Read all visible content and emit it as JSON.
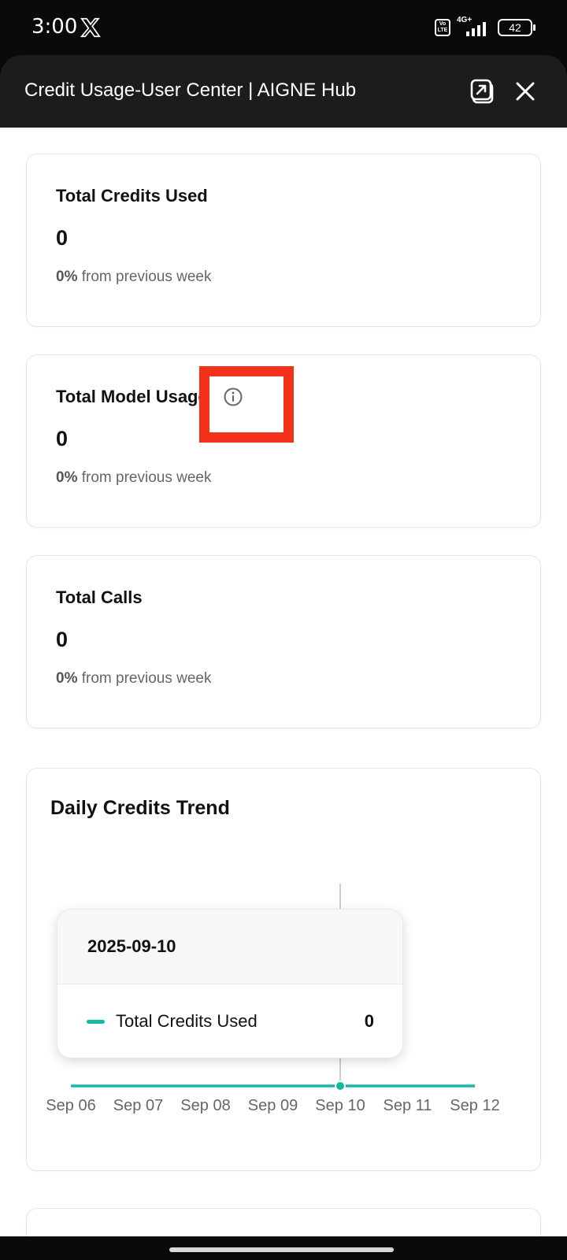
{
  "status_bar": {
    "time": "3:00",
    "volte_label": "Vo LTE",
    "network_label": "4G+",
    "battery": "42"
  },
  "header": {
    "title": "Credit Usage-User Center | AIGNE Hub"
  },
  "stats": [
    {
      "title": "Total Credits Used",
      "value": "0",
      "change": "0%",
      "change_suffix": " from previous week"
    },
    {
      "title": "Total Model Usage",
      "value": "0",
      "change": "0%",
      "change_suffix": " from previous week"
    },
    {
      "title": "Total Calls",
      "value": "0",
      "change": "0%",
      "change_suffix": " from previous week"
    }
  ],
  "chart": {
    "title": "Daily Credits Trend",
    "tooltip": {
      "date": "2025-09-10",
      "series_label": "Total Credits Used",
      "value": "0"
    }
  },
  "chart_data": {
    "type": "line",
    "title": "Daily Credits Trend",
    "categories": [
      "Sep 06",
      "Sep 07",
      "Sep 08",
      "Sep 09",
      "Sep 10",
      "Sep 11",
      "Sep 12"
    ],
    "series": [
      {
        "name": "Total Credits Used",
        "values": [
          0,
          0,
          0,
          0,
          0,
          0,
          0
        ]
      }
    ],
    "highlighted_index": 4,
    "color": "#14b8a6",
    "grid": false
  },
  "colors": {
    "accent": "#14b8a6",
    "highlight_box": "#f4311a"
  }
}
